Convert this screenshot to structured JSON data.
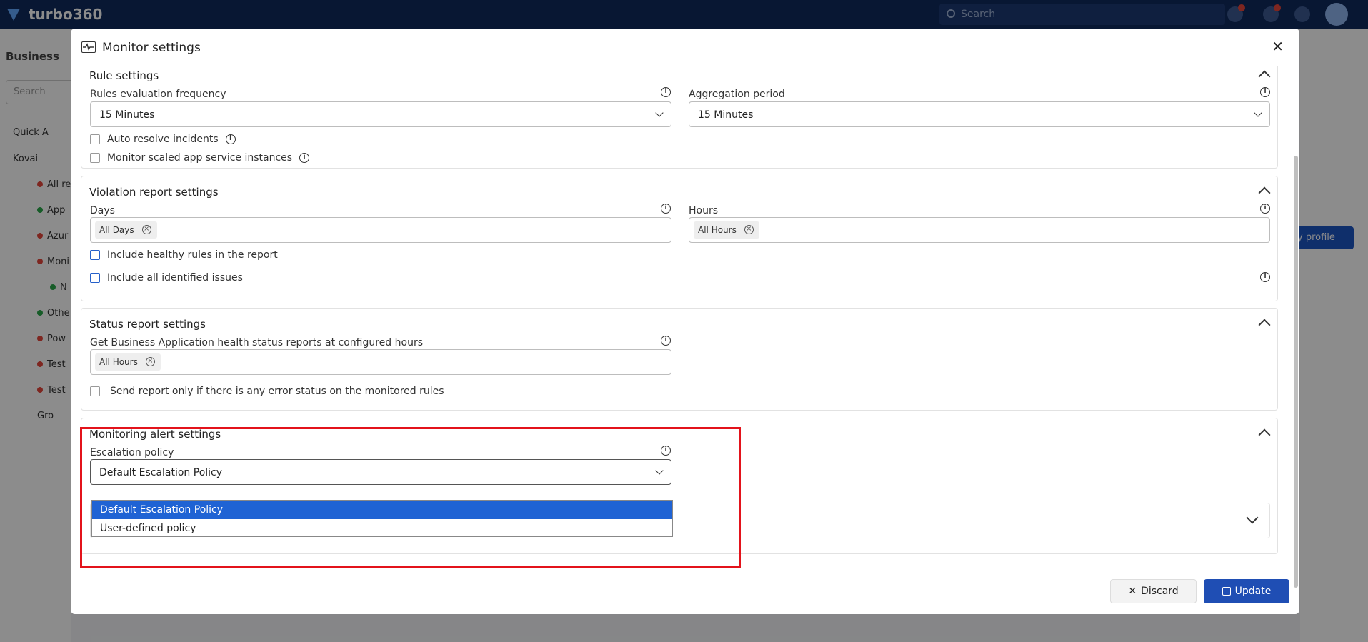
{
  "app": {
    "brand": "turbo360",
    "search_placeholder": "Search",
    "sidebar_title": "Business",
    "sidebar_search": "Search",
    "tree": [
      {
        "label": "Quick A",
        "color": ""
      },
      {
        "label": "Kovai",
        "color": "#e5463b"
      },
      {
        "label": "All re",
        "color": "#e5463b"
      },
      {
        "label": "App",
        "color": "#2aa84a"
      },
      {
        "label": "Azur",
        "color": "#e5463b"
      },
      {
        "label": "Moni",
        "color": "#e5463b"
      },
      {
        "label": "N",
        "color": "#2aa84a"
      },
      {
        "label": "Othe",
        "color": "#2aa84a"
      },
      {
        "label": "Pow",
        "color": "#e5463b"
      },
      {
        "label": "Test",
        "color": "#e5463b"
      },
      {
        "label": "Test",
        "color": "#e5463b"
      },
      {
        "label": "Gro",
        "color": ""
      }
    ],
    "right_button": "y profile"
  },
  "modal": {
    "title": "Monitor settings",
    "rule_settings": {
      "title": "Rule settings",
      "eval_label": "Rules evaluation frequency",
      "eval_value": "15 Minutes",
      "agg_label": "Aggregation period",
      "agg_value": "15 Minutes",
      "auto_resolve": "Auto resolve incidents",
      "scaled": "Monitor scaled app service instances"
    },
    "violation": {
      "title": "Violation report settings",
      "days_label": "Days",
      "days_tag": "All Days",
      "hours_label": "Hours",
      "hours_tag": "All Hours",
      "healthy": "Include healthy rules in the report",
      "issues": "Include all identified issues"
    },
    "status": {
      "title": "Status report settings",
      "hours_label": "Get Business Application health status reports at configured hours",
      "hours_tag": "All Hours",
      "error_only": "Send report only if there is any error status on the monitored rules"
    },
    "alert": {
      "title": "Monitoring alert settings",
      "policy_label": "Escalation policy",
      "policy_value": "Default Escalation Policy",
      "options": [
        "Default Escalation Policy",
        "User-defined policy"
      ]
    },
    "discard": "Discard",
    "update": "Update"
  }
}
